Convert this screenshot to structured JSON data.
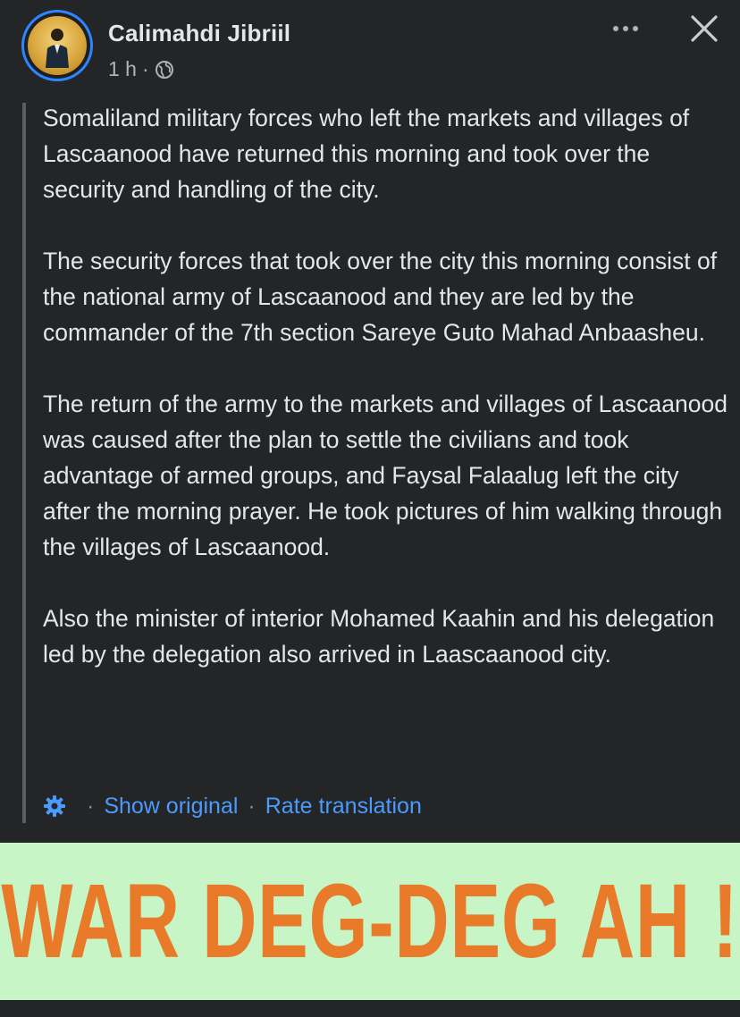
{
  "post": {
    "author": "Calimahdi Jibriil",
    "time": "1 h",
    "time_separator": "·",
    "audience_icon": "globe-icon",
    "paragraphs": [
      "Somaliland military forces who left the markets and villages of Lascaanood have returned this morning and took over the security and handling of the city.",
      "The security forces that took over the city this morning consist of the national army of Lascaanood and they are led by the commander of the 7th section Sareye Guto Mahad Anbaasheu.",
      "The return of the army to the markets and villages of Lascaanood was caused after the plan to settle the civilians and took advantage of armed groups, and Faysal Falaalug left the city after the morning prayer. He took pictures of him walking through the villages of Lascaanood.",
      "Also the minister of interior Mohamed Kaahin and his delegation led by the delegation also arrived in Laascaanood city."
    ],
    "translation": {
      "settings_icon": "gear-icon",
      "separator": "·",
      "show_original": "Show original",
      "rate_translation": "Rate translation"
    }
  },
  "banner": {
    "text": "WAR DEG-DEG AH !"
  },
  "colors": {
    "background": "#242526",
    "text": "#e4e6eb",
    "secondary_text": "#b0b3b8",
    "link": "#4b9bff",
    "banner_bg": "#c7f5c5",
    "banner_text": "#e87a2a",
    "avatar_ring": "#2d86ff"
  }
}
